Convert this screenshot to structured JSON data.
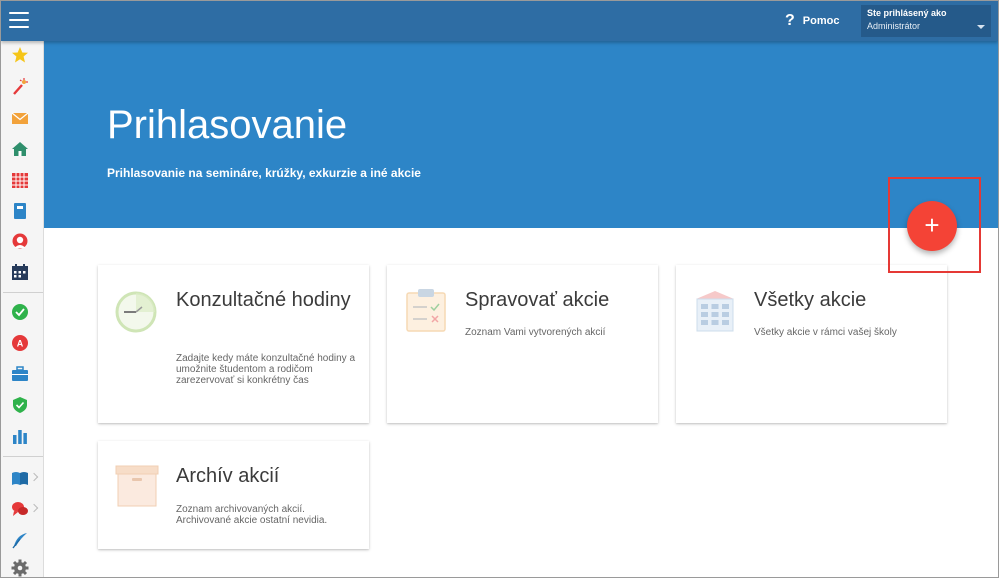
{
  "header": {
    "help_label": "Pomoc",
    "help_icon": "?",
    "user_caption": "Ste prihlásený ako",
    "user_role": "Administrátor"
  },
  "hero": {
    "title": "Prihlasovanie",
    "subtitle": "Prihlasovanie na semináre, krúžky, exkurzie a iné akcie"
  },
  "fab": {
    "label": "+"
  },
  "sidebar": {
    "icons": [
      "star-icon",
      "magic-wand-icon",
      "envelope-icon",
      "home-icon",
      "timetable-icon",
      "notebook-icon",
      "user-icon",
      "calendar-icon",
      "check-circle-icon",
      "grade-icon",
      "briefcase-icon",
      "shield-icon",
      "bar-chart-icon",
      "open-book-icon",
      "chat-icon",
      "feather-icon",
      "gear-icon"
    ]
  },
  "cards": [
    {
      "title": "Konzultačné hodiny",
      "description": "Zadajte kedy máte konzultačné hodiny a umožnite študentom a rodičom zarezervovať si konkrétny čas",
      "icon": "clock-icon"
    },
    {
      "title": "Spravovať akcie",
      "description": "Zoznam Vami vytvorených akcií",
      "icon": "clipboard-icon"
    },
    {
      "title": "Všetky akcie",
      "description": "Všetky akcie v rámci vašej školy",
      "icon": "building-icon"
    },
    {
      "title": "Archív akcií",
      "description": "Zoznam archivovaných akcií. Archivované akcie ostatní nevidia.",
      "icon": "archive-box-icon"
    }
  ],
  "colors": {
    "topbar": "#2e6da4",
    "hero": "#2d85c7",
    "fab": "#f44336",
    "highlight": "#e53935"
  }
}
